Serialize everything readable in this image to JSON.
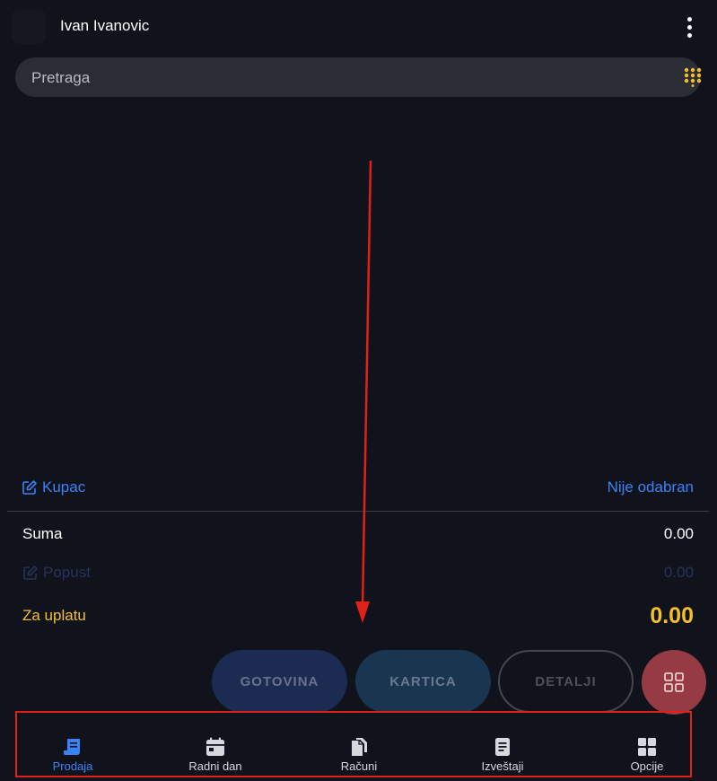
{
  "header": {
    "user_name": "Ivan Ivanovic",
    "menu_icon": "more-vertical-icon"
  },
  "search": {
    "placeholder": "Pretraga",
    "value": "",
    "keypad_icon": "dialpad-icon"
  },
  "customer": {
    "label": "Kupac",
    "value": "Nije odabran"
  },
  "totals": {
    "suma_label": "Suma",
    "suma_value": "0.00",
    "popust_label": "Popust",
    "popust_value": "0.00",
    "za_uplatu_label": "Za uplatu",
    "za_uplatu_value": "0.00"
  },
  "actions": {
    "gotovina": "GOTOVINA",
    "kartica": "KARTICA",
    "detalji": "DETALJI",
    "grid_icon": "grid-icon"
  },
  "nav": {
    "items": [
      {
        "label": "Prodaja",
        "icon": "receipt-icon",
        "active": true
      },
      {
        "label": "Radni dan",
        "icon": "calendar-icon",
        "active": false
      },
      {
        "label": "Računi",
        "icon": "documents-icon",
        "active": false
      },
      {
        "label": "Izveštaji",
        "icon": "report-icon",
        "active": false
      },
      {
        "label": "Opcije",
        "icon": "apps-icon",
        "active": false
      }
    ]
  },
  "colors": {
    "background": "#11131c",
    "accent_blue": "#3b82f6",
    "accent_yellow": "#f5bf2b",
    "annotation_red": "#e02117"
  }
}
